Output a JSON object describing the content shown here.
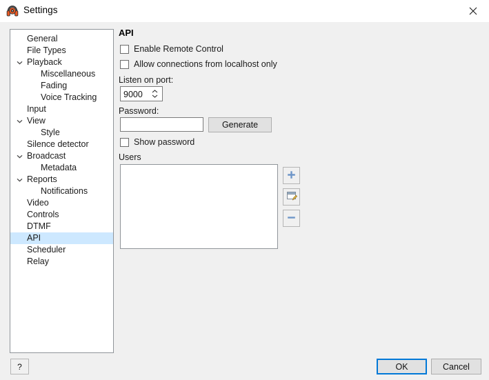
{
  "window": {
    "title": "Settings",
    "icon": "headphones-icon",
    "close_label": "✕"
  },
  "sidebar": {
    "items": [
      {
        "label": "General",
        "level": 0,
        "expander": "",
        "selected": false
      },
      {
        "label": "File Types",
        "level": 0,
        "expander": "",
        "selected": false
      },
      {
        "label": "Playback",
        "level": 0,
        "expander": "v",
        "selected": false
      },
      {
        "label": "Miscellaneous",
        "level": 1,
        "expander": "",
        "selected": false
      },
      {
        "label": "Fading",
        "level": 1,
        "expander": "",
        "selected": false
      },
      {
        "label": "Voice Tracking",
        "level": 1,
        "expander": "",
        "selected": false
      },
      {
        "label": "Input",
        "level": 0,
        "expander": "",
        "selected": false
      },
      {
        "label": "View",
        "level": 0,
        "expander": "v",
        "selected": false
      },
      {
        "label": "Style",
        "level": 1,
        "expander": "",
        "selected": false
      },
      {
        "label": "Silence detector",
        "level": 0,
        "expander": "",
        "selected": false
      },
      {
        "label": "Broadcast",
        "level": 0,
        "expander": "v",
        "selected": false
      },
      {
        "label": "Metadata",
        "level": 1,
        "expander": "",
        "selected": false
      },
      {
        "label": "Reports",
        "level": 0,
        "expander": "v",
        "selected": false
      },
      {
        "label": "Notifications",
        "level": 1,
        "expander": "",
        "selected": false
      },
      {
        "label": "Video",
        "level": 0,
        "expander": "",
        "selected": false
      },
      {
        "label": "Controls",
        "level": 0,
        "expander": "",
        "selected": false
      },
      {
        "label": "DTMF",
        "level": 0,
        "expander": "",
        "selected": false
      },
      {
        "label": "API",
        "level": 0,
        "expander": "",
        "selected": true
      },
      {
        "label": "Scheduler",
        "level": 0,
        "expander": "",
        "selected": false
      },
      {
        "label": "Relay",
        "level": 0,
        "expander": "",
        "selected": false
      }
    ],
    "selection_color": "#cde8ff"
  },
  "main": {
    "heading": "API",
    "enable_remote_control": {
      "label": "Enable Remote Control",
      "checked": false
    },
    "allow_localhost_only": {
      "label": "Allow connections from localhost only",
      "checked": false
    },
    "listen_port": {
      "label": "Listen on port:",
      "value": "9000"
    },
    "password": {
      "label": "Password:",
      "value": "",
      "placeholder": "",
      "generate_button": "Generate"
    },
    "show_password": {
      "label": "Show password",
      "checked": false
    },
    "users": {
      "label": "Users",
      "rows": [],
      "add_button_icon": "plus-icon",
      "edit_button_icon": "edit-icon",
      "remove_button_icon": "minus-icon"
    }
  },
  "footer": {
    "help_label": "?",
    "ok_label": "OK",
    "cancel_label": "Cancel",
    "focus_color": "#0078d7"
  }
}
